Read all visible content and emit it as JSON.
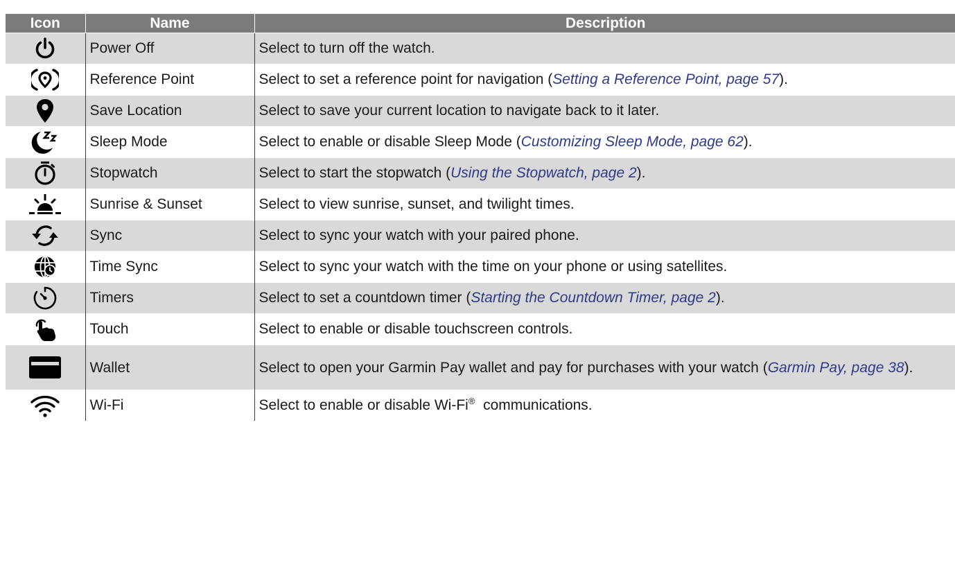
{
  "headers": {
    "icon": "Icon",
    "name": "Name",
    "description": "Description"
  },
  "rows": [
    {
      "icon": "power-off-icon",
      "name": "Power Off",
      "desc_before": "Select to turn off the watch.",
      "link": "",
      "desc_after": ""
    },
    {
      "icon": "reference-point-icon",
      "name": "Reference Point",
      "desc_before": "Select to set a reference point for navigation (",
      "link": "Setting a Reference Point, page 57",
      "desc_after": ")."
    },
    {
      "icon": "location-pin-icon",
      "name": "Save Location",
      "desc_before": "Select to save your current location to navigate back to it later.",
      "link": "",
      "desc_after": ""
    },
    {
      "icon": "sleep-moon-icon",
      "name": "Sleep Mode",
      "desc_before": "Select to enable or disable Sleep Mode (",
      "link": "Customizing Sleep Mode, page 62",
      "desc_after": ")."
    },
    {
      "icon": "stopwatch-icon",
      "name": "Stopwatch",
      "desc_before": "Select to start the stopwatch (",
      "link": "Using the Stopwatch, page 2",
      "desc_after": ")."
    },
    {
      "icon": "sunrise-icon",
      "name": "Sunrise & Sunset",
      "desc_before": "Select to view sunrise, sunset, and twilight times.",
      "link": "",
      "desc_after": ""
    },
    {
      "icon": "sync-icon",
      "name": "Sync",
      "desc_before": "Select to sync your watch with your paired phone.",
      "link": "",
      "desc_after": ""
    },
    {
      "icon": "time-sync-globe-icon",
      "name": "Time Sync",
      "desc_before": "Select to sync your watch with the time on your phone or using satellites.",
      "link": "",
      "desc_after": ""
    },
    {
      "icon": "timer-icon",
      "name": "Timers",
      "desc_before": "Select to set a countdown timer (",
      "link": "Starting the Countdown Timer, page 2",
      "desc_after": ")."
    },
    {
      "icon": "touch-hand-icon",
      "name": "Touch",
      "desc_before": "Select to enable or disable touchscreen controls.",
      "link": "",
      "desc_after": ""
    },
    {
      "icon": "wallet-card-icon",
      "name": "Wallet",
      "desc_before": "Select to open your Garmin Pay wallet and pay for purchases with your watch (",
      "link": "Garmin Pay, page 38",
      "desc_after": ")."
    },
    {
      "icon": "wifi-icon",
      "name": "Wi-Fi",
      "desc_before": "Select to enable or disable Wi-Fi",
      "sup": "®",
      "link": "",
      "desc_after": "  communications."
    }
  ]
}
